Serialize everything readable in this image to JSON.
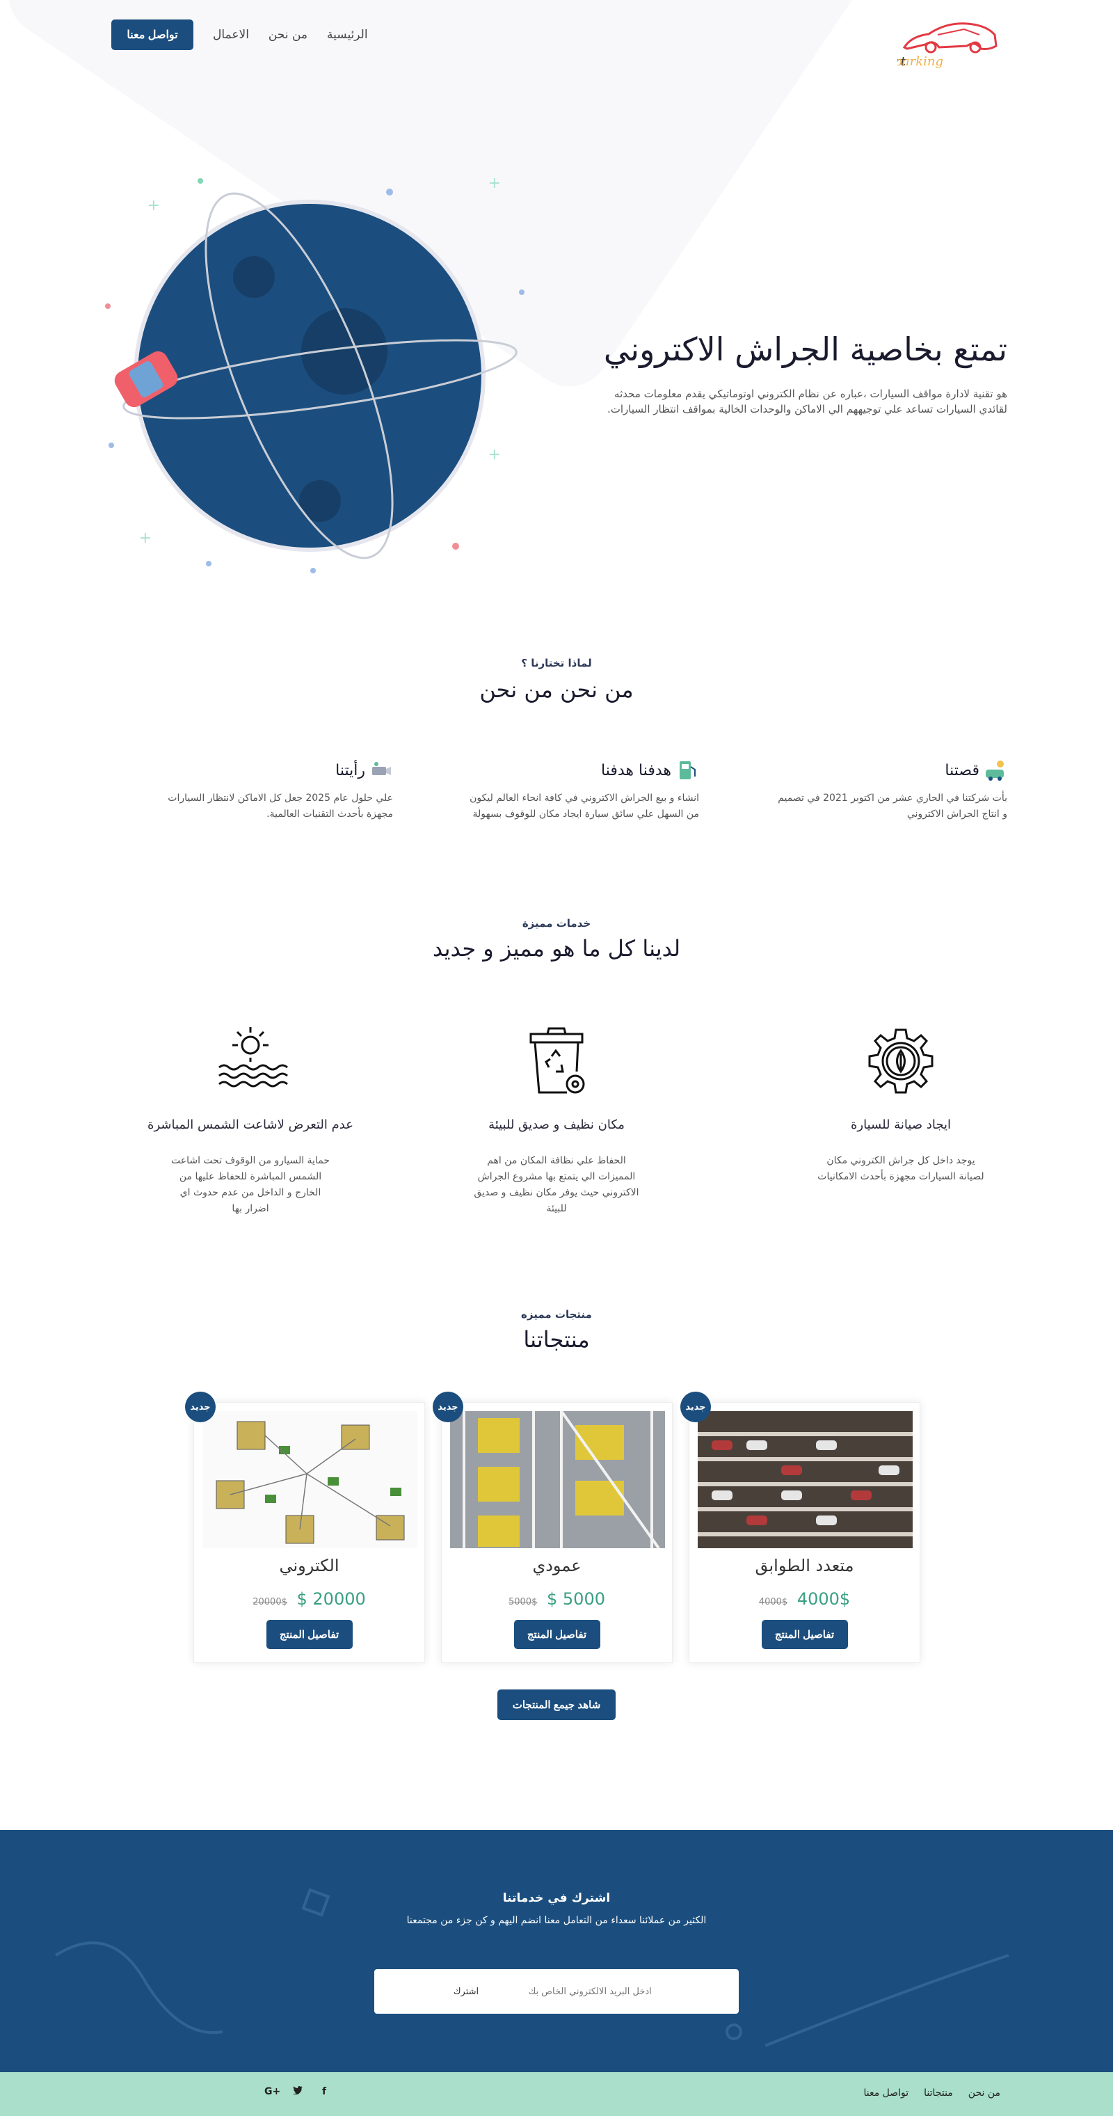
{
  "header": {
    "logo_text": "smart parking",
    "nav": {
      "home": "الرئيسية",
      "about": "من نحن",
      "works": "الاعمال",
      "contact": "تواصل معنا"
    }
  },
  "hero": {
    "title": "تمتع بخاصية الجراش الاكتروني",
    "text": "هو تقنية لادارة مواقف السيارات ،عباره عن نظام الكتروني اوتوماتيكي يقدم معلومات محدثه لقائدي السيارات تساعد علي توجيههم الي الاماكن والوحدات الخالية بمواقف انتظار السيارات."
  },
  "about": {
    "kicker": "لماذا تختارنا ؟",
    "title": "من نحن من نحن",
    "columns": [
      {
        "title": "قصتنا",
        "text": "بأت شركتنا في الحاري عشر من اكتوبر 2021 في تصميم و انتاج الجراش الاكتروني",
        "icon": "car-wash-icon"
      },
      {
        "title": "هدفنا هدفنا",
        "text": "انشاء و بيع الجراش الاكتروني في كافة انحاء العالم ليكون من السهل علي سائق سيارة ايجاد مكان للوقوف بسهولة",
        "icon": "fuel-pump-icon"
      },
      {
        "title": "رأيتنا",
        "text": "علي حلول عام 2025 جعل كل الاماكن لانتظار السيارات مجهزة بأحدث التقنيات العالمية.",
        "icon": "camera-icon"
      }
    ]
  },
  "services": {
    "kicker": "خدمات مميزة",
    "title": "لدينا كل ما هو مميز و جديد",
    "items": [
      {
        "title": "ايجاد صيانة للسيارة",
        "text": "يوجد داخل كل جراش الكتروني مكان لصيانة السيارات مجهزة بأحدث الامكانيات",
        "icon": "gear-leaf-icon"
      },
      {
        "title": "مكان نظيف و صديق للبيئة",
        "text": "الحفاظ علي نظافة المكان من اهم المميزات الي يتمتع بها مشروع الجراش الاكتروني حيث يوفر مكان نظيف و صديق للبيئة",
        "icon": "recycle-bin-icon"
      },
      {
        "title": "عدم التعرض لاشاعت الشمس المباشرة",
        "text": "حماية السيارو من الوقوف تحت اشاعت الشمس المباشرة للحفاظ عليها من الخارج و الداخل من عدم حدوث اي اضرار بها",
        "icon": "sun-sea-icon"
      }
    ]
  },
  "products": {
    "kicker": "منتجات مميزه",
    "title": "منتجاتنا",
    "badge": "جديد",
    "details_label": "تفاصيل المنتج",
    "all_label": "شاهد جيمع المنتجات",
    "items": [
      {
        "name": "متعدد الطوابق",
        "price": "4000$",
        "old_price": "4000$"
      },
      {
        "name": "عمودي",
        "price": "$ 5000",
        "old_price": "5000$"
      },
      {
        "name": "الكتروني",
        "price": "$ 20000",
        "old_price": "20000$"
      }
    ]
  },
  "newsletter": {
    "title": "اشترك في خدماتنا",
    "text": "الكثير من عملائنا سعداء من التعامل معنا انضم اليهم و كن جزء من مجتمعنا",
    "placeholder": "ادخل البريد الالكتروني الخاص بك",
    "button": "اشترك"
  },
  "footer": {
    "links": [
      "من نحن",
      "منتجاتنا",
      "تواصل معنا"
    ],
    "socials": [
      "f",
      "t",
      "G+"
    ]
  },
  "colors": {
    "primary": "#1b4e7e",
    "accent": "#3a9f82",
    "footer": "#a9dfcb"
  }
}
